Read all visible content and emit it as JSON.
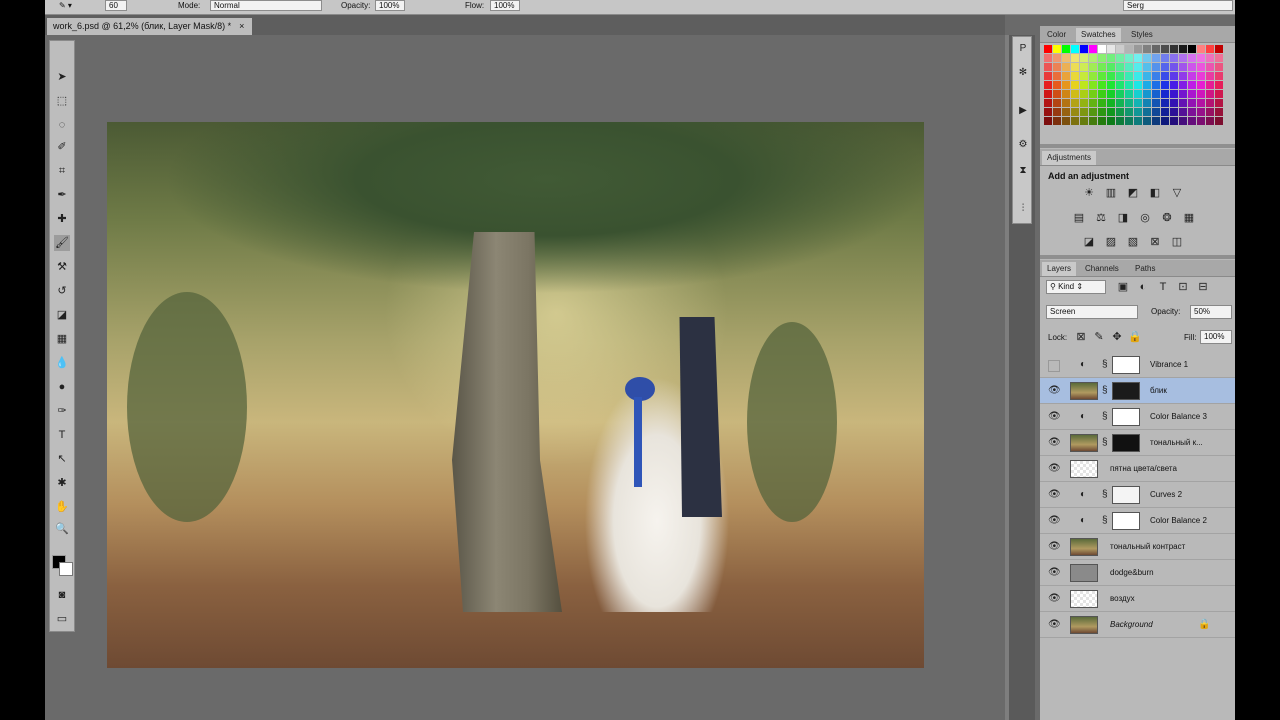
{
  "options_bar": {
    "brush_size": "60",
    "mode_label": "Mode:",
    "mode_value": "Normal",
    "opacity_label": "Opacity:",
    "opacity_value": "100%",
    "flow_label": "Flow:",
    "flow_value": "100%",
    "workspace": "Serg"
  },
  "document": {
    "tab_title": "work_6.psd @ 61,2% (блик, Layer Mask/8) *",
    "close_symbol": "×"
  },
  "panels": {
    "color_tabs": [
      "Color",
      "Swatches",
      "Styles"
    ],
    "adjustments_tab": "Adjustments",
    "adjustments_heading": "Add an adjustment",
    "layers_tabs": [
      "Layers",
      "Channels",
      "Paths"
    ],
    "kind_label": "Kind",
    "blend_mode": "Screen",
    "opacity_label": "Opacity:",
    "opacity_value": "50%",
    "lock_label": "Lock:",
    "fill_label": "Fill:",
    "fill_value": "100%"
  },
  "layers": [
    {
      "name": "Vibrance 1",
      "visible": false,
      "selected": false,
      "italic": false
    },
    {
      "name": "блик",
      "visible": true,
      "selected": true,
      "italic": false
    },
    {
      "name": "Color Balance 3",
      "visible": true,
      "selected": false,
      "italic": false
    },
    {
      "name": "тональный к...",
      "visible": true,
      "selected": false,
      "italic": false
    },
    {
      "name": "пятна цвета/света",
      "visible": true,
      "selected": false,
      "italic": false
    },
    {
      "name": "Curves 2",
      "visible": true,
      "selected": false,
      "italic": false
    },
    {
      "name": "Color Balance 2",
      "visible": true,
      "selected": false,
      "italic": false
    },
    {
      "name": "тональный контраст",
      "visible": true,
      "selected": false,
      "italic": false
    },
    {
      "name": "dodge&burn",
      "visible": true,
      "selected": false,
      "italic": false
    },
    {
      "name": "воздух",
      "visible": true,
      "selected": false,
      "italic": false
    },
    {
      "name": "Background",
      "visible": true,
      "selected": false,
      "italic": true
    }
  ],
  "icons": {
    "eye": "👁",
    "lock": "🔒"
  }
}
